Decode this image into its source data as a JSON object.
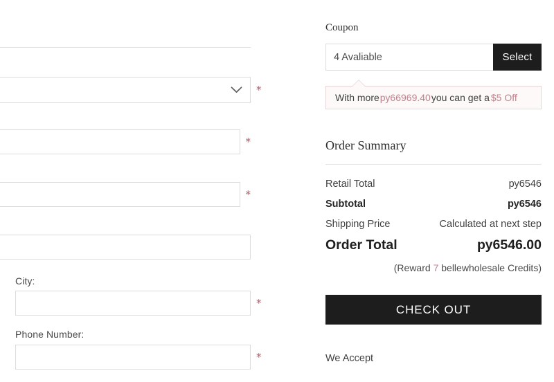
{
  "form": {
    "fields": [
      {
        "name": "country-select",
        "label": "",
        "value": "",
        "placeholder": "",
        "required": true,
        "type": "select"
      },
      {
        "name": "address-line-1",
        "label": "",
        "value": "",
        "placeholder": "",
        "required": true,
        "type": "text"
      },
      {
        "name": "address-line-2",
        "label": "",
        "value": "",
        "placeholder": "",
        "required": true,
        "type": "text"
      },
      {
        "name": "state-province",
        "label": "",
        "value": "",
        "placeholder": "",
        "required": false,
        "type": "text"
      },
      {
        "name": "city",
        "label": "City:",
        "value": "",
        "placeholder": "",
        "required": true,
        "type": "text"
      },
      {
        "name": "phone-number",
        "label": "Phone Number:",
        "value": "",
        "placeholder": "",
        "required": true,
        "type": "text"
      }
    ],
    "required_marker": "*"
  },
  "coupon": {
    "heading": "Coupon",
    "input_value": "4 Avaliable",
    "input_placeholder": "4 Avaliable",
    "select_label": "Select",
    "tip_prefix": "With more",
    "tip_amount": "ру66969.40",
    "tip_middle": "you can get a",
    "tip_discount": "$5 Off"
  },
  "order_summary": {
    "title": "Order Summary",
    "rows": [
      {
        "label": "Retail Total",
        "value": "ру6546"
      },
      {
        "label": "Subtotal",
        "value": "ру6546"
      },
      {
        "label": "Shipping Price",
        "value": "Calculated at next step"
      },
      {
        "label": "Order Total",
        "value": "ру6546.00"
      }
    ],
    "reward_open": "(Reward",
    "reward_points": "7",
    "reward_close": "bellewholesale Credits)"
  },
  "actions": {
    "checkout_label": "CHECK OUT"
  },
  "payments": {
    "heading": "We Accept"
  },
  "colors": {
    "accent_rose": "#c0808c",
    "required_star": "#b05a6a",
    "button_dark": "#1d1d1d",
    "tip_border": "#e7d4d6",
    "tip_background": "#fdf9f9",
    "field_border": "#dcdcdc"
  }
}
